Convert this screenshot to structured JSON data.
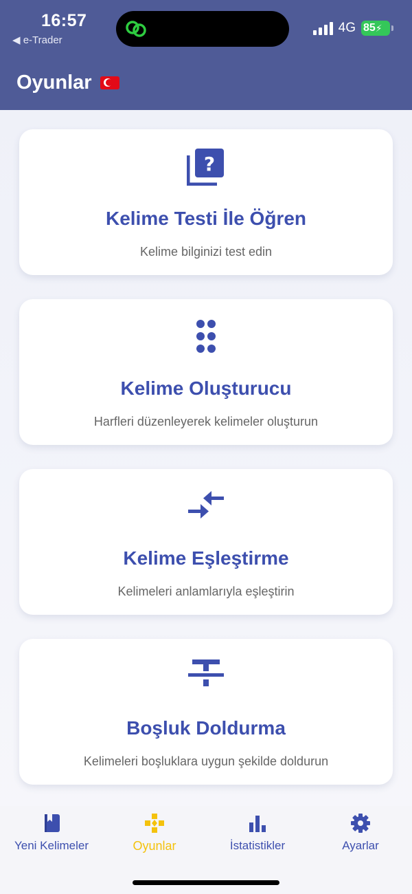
{
  "status_bar": {
    "time": "16:57",
    "back_app": "◀ e-Trader",
    "network": "4G",
    "battery": "85"
  },
  "header": {
    "title": "Oyunlar",
    "flag": "🇹🇷"
  },
  "colors": {
    "header_bg": "#4f5b97",
    "accent": "#3d4fae",
    "active_tab": "#f4c20d"
  },
  "games": [
    {
      "icon": "quiz-icon",
      "title": "Kelime Testi İle Öğren",
      "description": "Kelime bilginizi test edin"
    },
    {
      "icon": "dots-grid-icon",
      "title": "Kelime Oluşturucu",
      "description": "Harfleri düzenleyerek kelimeler oluşturun"
    },
    {
      "icon": "compare-arrows-icon",
      "title": "Kelime Eşleştirme",
      "description": "Kelimeleri anlamlarıyla eşleştirin"
    },
    {
      "icon": "strikethrough-icon",
      "title": "Boşluk Doldurma",
      "description": "Kelimeleri boşluklara uygun şekilde doldurun"
    }
  ],
  "tabs": [
    {
      "icon": "book-icon",
      "label": "Yeni Kelimeler",
      "active": false
    },
    {
      "icon": "gamepad-icon",
      "label": "Oyunlar",
      "active": true
    },
    {
      "icon": "bar-chart-icon",
      "label": "İstatistikler",
      "active": false
    },
    {
      "icon": "gear-icon",
      "label": "Ayarlar",
      "active": false
    }
  ]
}
